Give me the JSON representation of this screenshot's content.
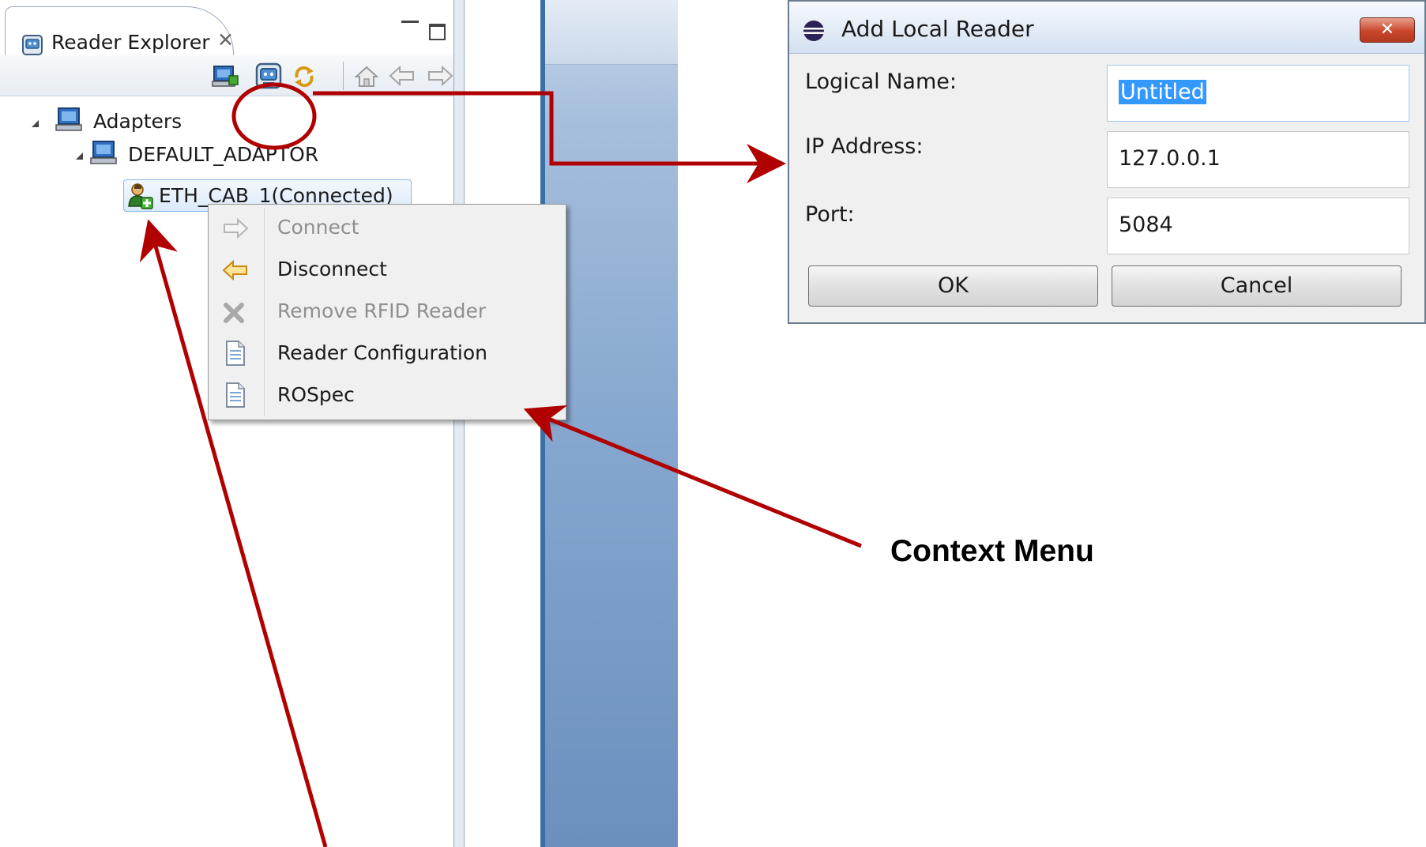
{
  "explorer": {
    "tab_title": "Reader Explorer",
    "tab_icon": "reader-icon",
    "toolbar_icons": [
      "add-adapter-icon",
      "add-reader-icon",
      "refresh-icon",
      "home-icon",
      "back-icon",
      "forward-icon",
      "view-menu-icon"
    ]
  },
  "tree": {
    "root_label": "Adapters",
    "adaptor_label": "DEFAULT_ADAPTOR",
    "reader_label": "ETH_CAB_1(Connected)"
  },
  "context_menu": {
    "items": [
      {
        "label": "Connect",
        "icon": "connect-arrow-icon",
        "enabled": false
      },
      {
        "label": "Disconnect",
        "icon": "disconnect-arrow-icon",
        "enabled": true
      },
      {
        "label": "Remove RFID Reader",
        "icon": "remove-icon",
        "enabled": false
      },
      {
        "label": "Reader Configuration",
        "icon": "document-icon",
        "enabled": true
      },
      {
        "label": "ROSpec",
        "icon": "document-icon",
        "enabled": true
      }
    ]
  },
  "dialog": {
    "title": "Add Local Reader",
    "close_glyph": "✕",
    "logical_name_label": "Logical Name:",
    "logical_name_value": "Untitled",
    "ip_label": "IP Address:",
    "ip_value": "127.0.0.1",
    "port_label": "Port:",
    "port_value": "5084",
    "ok_label": "OK",
    "cancel_label": "Cancel"
  },
  "annotations": {
    "context_menu_callout": "Context Menu",
    "arrow_color": "#b00000"
  }
}
